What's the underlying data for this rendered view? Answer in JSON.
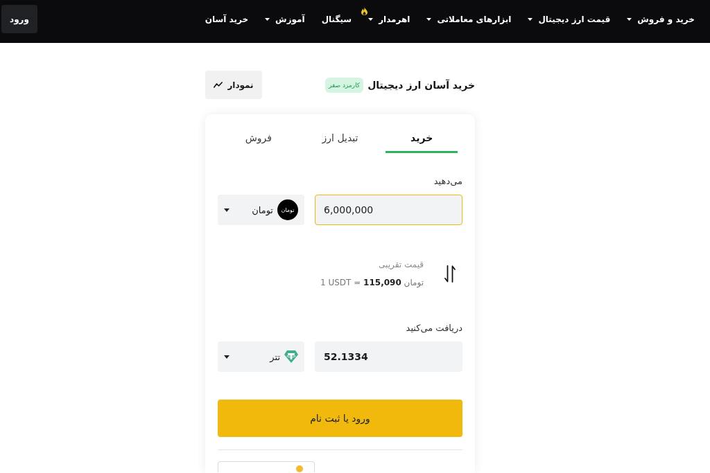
{
  "nav": {
    "items": [
      {
        "label": "خرید و فروش",
        "dropdown": true,
        "hot": false
      },
      {
        "label": "قیمت ارز دیجیتال",
        "dropdown": true,
        "hot": false
      },
      {
        "label": "ابزارهای معاملاتی",
        "dropdown": true,
        "hot": false
      },
      {
        "label": "اهرمدار",
        "dropdown": true,
        "hot": true
      },
      {
        "label": "سیگنال",
        "dropdown": false,
        "hot": false
      },
      {
        "label": "آموزش",
        "dropdown": true,
        "hot": false
      },
      {
        "label": "خرید آسان",
        "dropdown": false,
        "hot": false
      }
    ],
    "login": "ورود"
  },
  "header": {
    "title": "خرید آسان ارز دیجیتال",
    "badge": "کارمزد صفر",
    "chart_button": "نمودار"
  },
  "tabs": [
    {
      "label": "خرید",
      "selected": true
    },
    {
      "label": "تبدیل ارز",
      "selected": false
    },
    {
      "label": "فروش",
      "selected": false
    }
  ],
  "pay": {
    "label": "می‌دهید",
    "value": "6,000,000",
    "focused": true,
    "readonly": false,
    "currency": {
      "kind": "toman",
      "name": "تومان",
      "logo_text": "تومان"
    }
  },
  "rate": {
    "label": "قیمت تقریبی",
    "text": "1 USDT = **115,090** تومان"
  },
  "receive": {
    "label": "دریافت می‌کنید",
    "value": "52.1334",
    "focused": false,
    "readonly": true,
    "currency": {
      "kind": "tether",
      "name": "تتر"
    }
  },
  "submit": "ورود یا ثبت نام"
}
